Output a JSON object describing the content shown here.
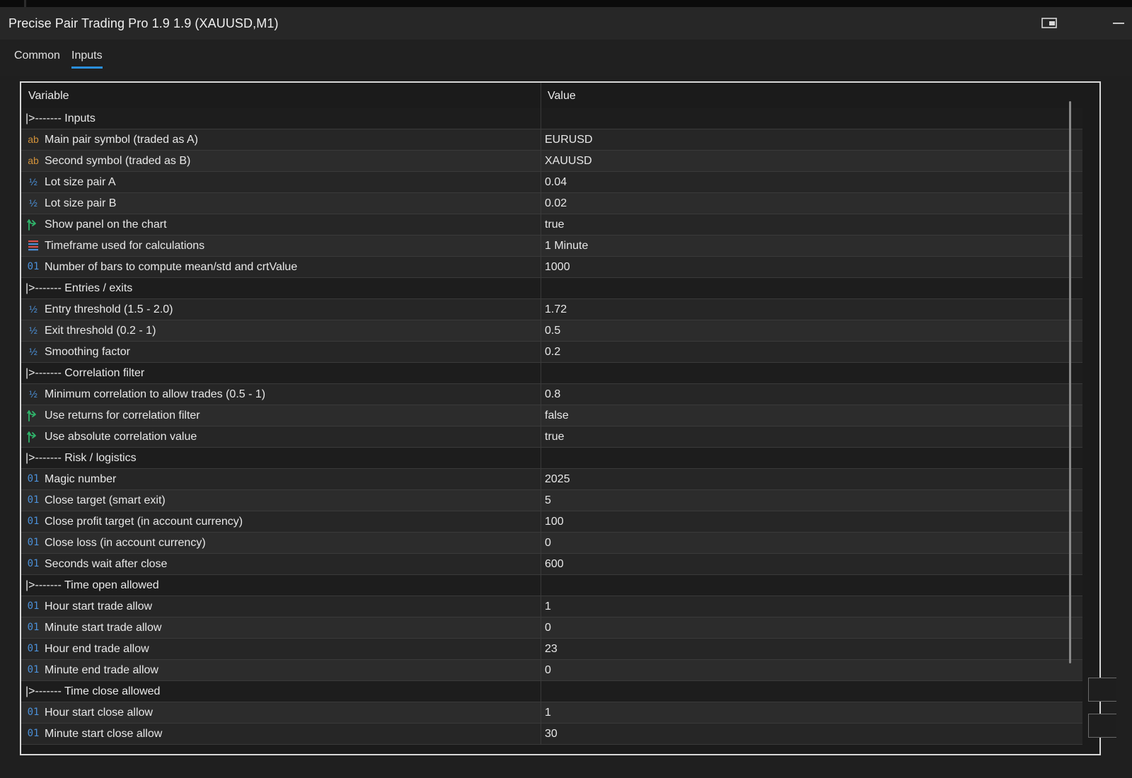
{
  "window": {
    "title": "Precise Pair Trading Pro 1.9 1.9 (XAUUSD,M1)"
  },
  "tabs": [
    {
      "label": "Common"
    },
    {
      "label": "Inputs"
    }
  ],
  "table": {
    "columns": {
      "variable": "Variable",
      "value": "Value"
    },
    "rows": [
      {
        "type": "section",
        "label": "|>------- Inputs",
        "value": ""
      },
      {
        "type": "string",
        "icon": "ab",
        "label": "Main pair symbol (traded as A)",
        "value": "EURUSD"
      },
      {
        "type": "string",
        "icon": "ab",
        "label": "Second symbol (traded as B)",
        "value": "XAUUSD"
      },
      {
        "type": "double",
        "icon": "½",
        "label": "Lot size pair A",
        "value": "0.04"
      },
      {
        "type": "double",
        "icon": "½",
        "label": "Lot size pair B",
        "value": "0.02"
      },
      {
        "type": "bool",
        "icon": "bool-arrow-icon",
        "label": "Show panel on the chart",
        "value": "true"
      },
      {
        "type": "enum",
        "icon": "enum-list-icon",
        "label": "Timeframe used for calculations",
        "value": "1 Minute"
      },
      {
        "type": "int",
        "icon": "01",
        "label": "Number of bars to compute mean/std and crtValue",
        "value": "1000"
      },
      {
        "type": "section",
        "label": "|>------- Entries / exits",
        "value": ""
      },
      {
        "type": "double",
        "icon": "½",
        "label": "Entry threshold (1.5 - 2.0)",
        "value": "1.72"
      },
      {
        "type": "double",
        "icon": "½",
        "label": "Exit threshold (0.2 - 1)",
        "value": "0.5"
      },
      {
        "type": "double",
        "icon": "½",
        "label": "Smoothing factor",
        "value": "0.2"
      },
      {
        "type": "section",
        "label": "|>------- Correlation filter",
        "value": ""
      },
      {
        "type": "double",
        "icon": "½",
        "label": "Minimum correlation to allow trades (0.5 - 1)",
        "value": "0.8"
      },
      {
        "type": "bool",
        "icon": "bool-arrow-icon",
        "label": "Use returns for correlation filter",
        "value": "false"
      },
      {
        "type": "bool",
        "icon": "bool-arrow-icon",
        "label": "Use absolute correlation value",
        "value": "true"
      },
      {
        "type": "section",
        "label": "|>------- Risk / logistics",
        "value": ""
      },
      {
        "type": "int",
        "icon": "01",
        "label": "Magic number",
        "value": "2025"
      },
      {
        "type": "int",
        "icon": "01",
        "label": "Close target (smart exit)",
        "value": "5"
      },
      {
        "type": "int",
        "icon": "01",
        "label": "Close profit target (in account currency)",
        "value": "100"
      },
      {
        "type": "int",
        "icon": "01",
        "label": "Close loss (in account currency)",
        "value": "0"
      },
      {
        "type": "int",
        "icon": "01",
        "label": "Seconds wait after close",
        "value": "600"
      },
      {
        "type": "section",
        "label": "|>------- Time open allowed",
        "value": ""
      },
      {
        "type": "int",
        "icon": "01",
        "label": "Hour start trade allow",
        "value": "1"
      },
      {
        "type": "int",
        "icon": "01",
        "label": "Minute start trade allow",
        "value": "0"
      },
      {
        "type": "int",
        "icon": "01",
        "label": "Hour end trade allow",
        "value": "23"
      },
      {
        "type": "int",
        "icon": "01",
        "label": "Minute end trade allow",
        "value": "0"
      },
      {
        "type": "section",
        "label": "|>------- Time close allowed",
        "value": ""
      },
      {
        "type": "int",
        "icon": "01",
        "label": "Hour start close allow",
        "value": "1"
      },
      {
        "type": "int",
        "icon": "01",
        "label": "Minute start close allow",
        "value": "30"
      }
    ]
  },
  "colors": {
    "accent": "#2a8fdc",
    "string_icon": "#d1913a",
    "numeric_icon": "#4b90d8",
    "bool_icon": "#2fb36a",
    "enum_icon": "#d8504a"
  }
}
